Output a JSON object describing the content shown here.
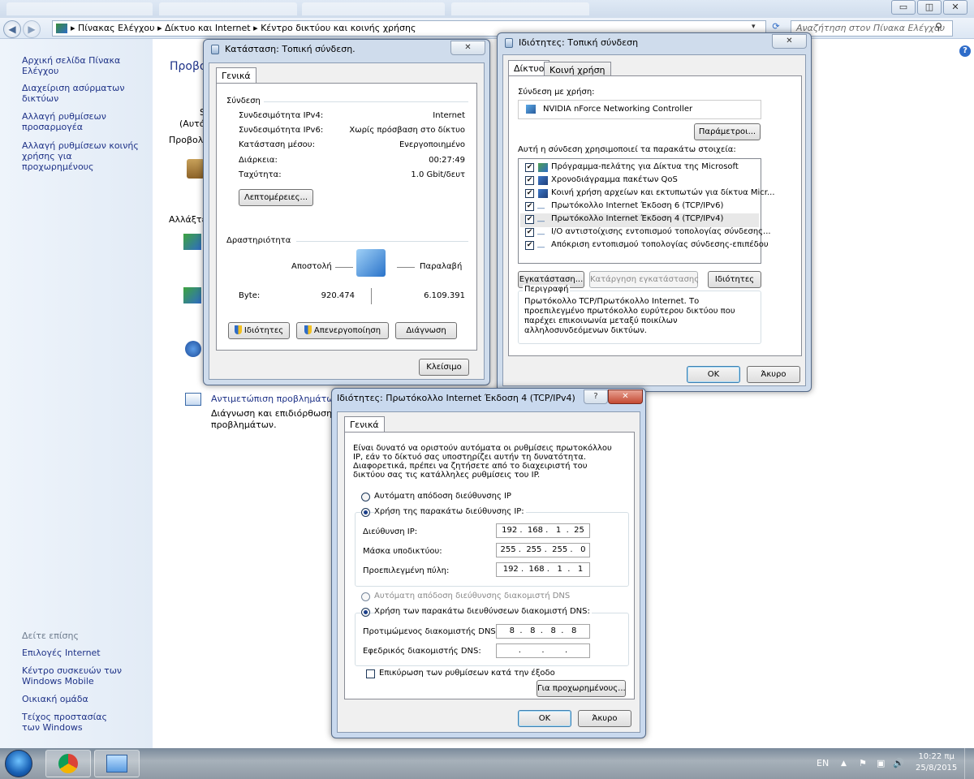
{
  "window": {
    "minimize_icon": "minimize-icon",
    "maximize_icon": "maximize-icon",
    "close_icon": "close-icon"
  },
  "address_bar": {
    "breadcrumb": [
      "Πίνακας Ελέγχου",
      "Δίκτυο και Internet",
      "Κέντρο δικτύου και κοινής χρήσης"
    ],
    "search_placeholder": "Αναζήτηση στον Πίνακα Ελέγχου"
  },
  "sidebar": {
    "items": [
      "Αρχική σελίδα Πίνακα Ελέγχου",
      "Διαχείριση ασύρματων δικτύων",
      "Αλλαγή ρυθμίσεων προσαρμογέα",
      "Αλλαγή ρυθμίσεων κοινής χρήσης για προχωρημένους"
    ],
    "see_also_title": "Δείτε επίσης",
    "see_also": [
      "Επιλογές Internet",
      "Κέντρο συσκευών των Windows Mobile",
      "Οικιακή ομάδα",
      "Τείχος προστασίας των Windows"
    ]
  },
  "main": {
    "fragments": [
      "Προβολ",
      "S",
      "(Αυτό",
      "Προβολ",
      "Αλλάξτε"
    ],
    "troubleshoot_link": "Αντιμετώπιση προβλημάτων",
    "troubleshoot_desc": "Διάγνωση και επιδιόρθωση π",
    "troubleshoot_desc2": "προβλημάτων."
  },
  "status_dialog": {
    "title": "Κατάσταση: Τοπική σύνδεση.",
    "tab": "Γενικά",
    "section_connection": "Σύνδεση",
    "rows": [
      {
        "label": "Συνδεσιμότητα IPv4:",
        "value": "Internet"
      },
      {
        "label": "Συνδεσιμότητα IPv6:",
        "value": "Χωρίς πρόσβαση στο δίκτυο"
      },
      {
        "label": "Κατάσταση μέσου:",
        "value": "Ενεργοποιημένο"
      },
      {
        "label": "Διάρκεια:",
        "value": "00:27:49"
      },
      {
        "label": "Ταχύτητα:",
        "value": "1.0 Gbit/δευτ"
      }
    ],
    "details_button": "Λεπτομέρειες...",
    "section_activity": "Δραστηριότητα",
    "sent_label": "Αποστολή",
    "received_label": "Παραλαβή",
    "bytes_label": "Byte:",
    "bytes_sent": "920.474",
    "bytes_received": "6.109.391",
    "properties_button": "Ιδιότητες",
    "disable_button": "Απενεργοποίηση",
    "diagnose_button": "Διάγνωση",
    "close_button": "Κλείσιμο"
  },
  "props_dialog": {
    "title": "Ιδιότητες: Τοπική σύνδεση",
    "tabs": [
      "Δίκτυο",
      "Κοινή χρήση"
    ],
    "connect_using_label": "Σύνδεση με χρήση:",
    "adapter_name": "NVIDIA nForce Networking Controller",
    "configure_button": "Παράμετροι...",
    "items_label": "Αυτή η σύνδεση χρησιμοποιεί τα παρακάτω στοιχεία:",
    "items": [
      "Πρόγραμμα-πελάτης για Δίκτυα της Microsoft",
      "Χρονοδιάγραμμα πακέτων QoS",
      "Κοινή χρήση αρχείων και εκτυπωτών για δίκτυα Micr...",
      "Πρωτόκολλο Internet Έκδοση 6 (TCP/IPv6)",
      "Πρωτόκολλο Internet Έκδοση 4 (TCP/IPv4)",
      "I/O αντιστοίχισης εντοπισμού τοπολογίας σύνδεσης...",
      "Απόκριση εντοπισμού τοπολογίας σύνδεσης-επιπέδου"
    ],
    "install_button": "Εγκατάσταση...",
    "uninstall_button": "Κατάργηση εγκατάστασης",
    "properties_button": "Ιδιότητες",
    "description_title": "Περιγραφή",
    "description": "Πρωτόκολλο TCP/Πρωτόκολλο Internet. Το προεπιλεγμένο πρωτόκολλο ευρύτερου δικτύου που παρέχει επικοινωνία μεταξύ ποικίλων αλληλοσυνδεόμενων δικτύων.",
    "ok_button": "OK",
    "cancel_button": "Άκυρο"
  },
  "ipv4_dialog": {
    "title": "Ιδιότητες: Πρωτόκολλο Internet Έκδοση 4 (TCP/IPv4)",
    "help_button": "?",
    "tab": "Γενικά",
    "intro": "Είναι δυνατό να οριστούν αυτόματα οι ρυθμίσεις πρωτοκόλλου IP, εάν το δίκτυό σας υποστηρίζει αυτήν τη δυνατότητα. Διαφορετικά, πρέπει να ζητήσετε από το διαχειριστή του δικτύου σας τις κατάλληλες ρυθμίσεις του IP.",
    "auto_ip": "Αυτόματη απόδοση διεύθυνσης IP",
    "manual_ip": "Χρήση της παρακάτω διεύθυνσης IP:",
    "ip_label": "Διεύθυνση IP:",
    "ip_value": "192 .  168 .   1  .  25",
    "mask_label": "Μάσκα υποδικτύου:",
    "mask_value": "255 .  255 .  255 .   0",
    "gateway_label": "Προεπιλεγμένη πύλη:",
    "gateway_value": "192 .  168 .   1  .   1",
    "auto_dns": "Αυτόματη απόδοση διεύθυνσης διακομιστή DNS",
    "manual_dns": "Χρήση των παρακάτω διευθύνσεων διακομιστή DNS:",
    "pref_dns_label": "Προτιμώμενος διακομιστής DNS:",
    "pref_dns_value": "8  .   8  .   8  .   8",
    "alt_dns_label": "Εφεδρικός διακομιστής DNS:",
    "alt_dns_value": ".        .        .",
    "validate_label": "Επικύρωση των ρυθμίσεων κατά την έξοδο",
    "advanced_button": "Για προχωρημένους...",
    "ok_button": "OK",
    "cancel_button": "Άκυρο"
  },
  "taskbar": {
    "lang": "EN",
    "time": "10:22 πμ",
    "date": "25/8/2015"
  }
}
